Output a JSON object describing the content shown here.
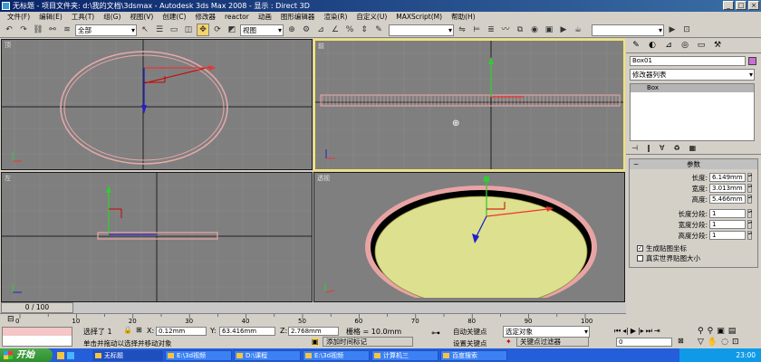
{
  "window": {
    "title": "无标题    - 项目文件夹: d:\\我的文档\\3dsmax    - Autodesk 3ds Max 2008    - 显示 : Direct 3D"
  },
  "menu": [
    "文件(F)",
    "编辑(E)",
    "工具(T)",
    "组(G)",
    "视图(V)",
    "创建(C)",
    "修改器",
    "reactor",
    "动画",
    "图形编辑器",
    "渲染(R)",
    "自定义(U)",
    "MAXScript(M)",
    "帮助(H)"
  ],
  "toolbar": {
    "selection_filter": "全部",
    "ref_coord": "视图"
  },
  "viewports": {
    "top": "顶",
    "front": "前",
    "left": "左",
    "perspective": "透视"
  },
  "panel": {
    "object_name": "Box01",
    "modifier_list": "修改器列表",
    "stack_item": "Box",
    "params_title": "参数",
    "params": [
      {
        "label": "长度:",
        "value": "6.149mm"
      },
      {
        "label": "宽度:",
        "value": "3.013mm"
      },
      {
        "label": "高度:",
        "value": "5.466mm"
      }
    ],
    "segments": [
      {
        "label": "长度分段:",
        "value": "1"
      },
      {
        "label": "宽度分段:",
        "value": "1"
      },
      {
        "label": "高度分段:",
        "value": "1"
      }
    ],
    "gen_map": "生成贴图坐标",
    "real_world": "真实世界贴图大小"
  },
  "timeline": {
    "frame": "0 / 100",
    "ticks": [
      "0",
      "10",
      "20",
      "30",
      "40",
      "50",
      "60",
      "70",
      "80",
      "90",
      "100"
    ]
  },
  "status": {
    "selected": "选择了 1",
    "x": "0.12mm",
    "y": "63.416mm",
    "z": "2.768mm",
    "grid": "栅格 = 10.0mm",
    "prompt": "单击并拖动以选择并移动对象",
    "add_tag": "添加时间标记",
    "auto_key": "自动关键点",
    "set_key": "设置关键点",
    "selected_obj": "选定对象",
    "key_filter": "关键点过滤器",
    "frame_value": "0"
  },
  "taskbar": {
    "start": "开始",
    "items": [
      "无标题",
      "E:\\3d视频",
      "D:\\课程",
      "E:\\3d视频",
      "计算机三",
      "百度搜索"
    ],
    "clock": "23:00"
  }
}
